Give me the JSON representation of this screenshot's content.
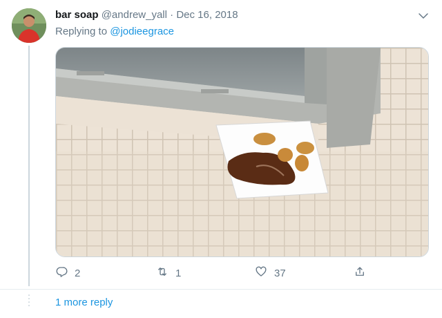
{
  "tweet": {
    "author_name": "bar soap",
    "author_handle": "@andrew_yall",
    "separator": "·",
    "date": "Dec 16, 2018",
    "replying_prefix": "Replying to",
    "replying_user": "@jodieegrace",
    "actions": {
      "reply_count": "2",
      "retweet_count": "1",
      "like_count": "37"
    }
  },
  "thread": {
    "more_replies": "1 more reply"
  },
  "icons": {
    "caret": "chevron-down-icon",
    "reply": "reply-icon",
    "retweet": "retweet-icon",
    "like": "heart-icon",
    "share": "share-icon"
  },
  "colors": {
    "link": "#1b95e0",
    "secondary_text": "#657786",
    "border": "#ccd6dd"
  }
}
